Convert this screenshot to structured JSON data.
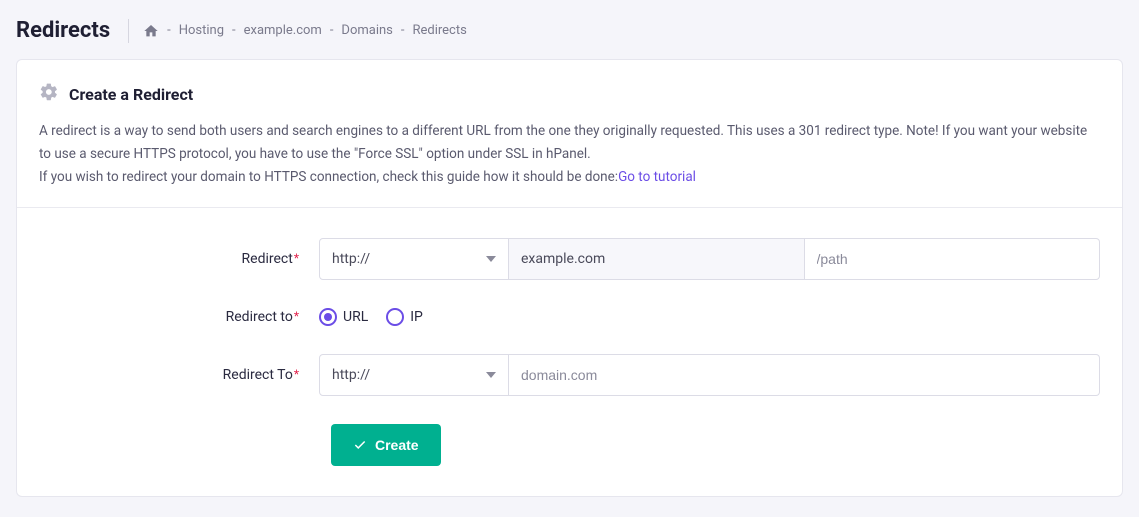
{
  "header": {
    "title": "Redirects",
    "breadcrumb": [
      "Hosting",
      "example.com",
      "Domains",
      "Redirects"
    ]
  },
  "card": {
    "title": "Create a Redirect",
    "description_line1": "A redirect is a way to send both users and search engines to a different URL from the one they originally requested. This uses a 301 redirect type. Note! If you want your website to use a secure HTTPS protocol, you have to use the \"Force SSL\" option under SSL in hPanel.",
    "description_line2_prefix": "If you wish to redirect your domain to HTTPS connection, check this guide how it should be done:",
    "tutorial_link_text": "Go to tutorial"
  },
  "form": {
    "redirect_label": "Redirect",
    "redirect_to_radio_label": "Redirect to",
    "redirect_to_dest_label": "Redirect To",
    "protocol1": "http://",
    "domain_value": "example.com",
    "path_placeholder": "/path",
    "radio_url": "URL",
    "radio_ip": "IP",
    "protocol2": "http://",
    "dest_placeholder": "domain.com",
    "create_button": "Create"
  }
}
